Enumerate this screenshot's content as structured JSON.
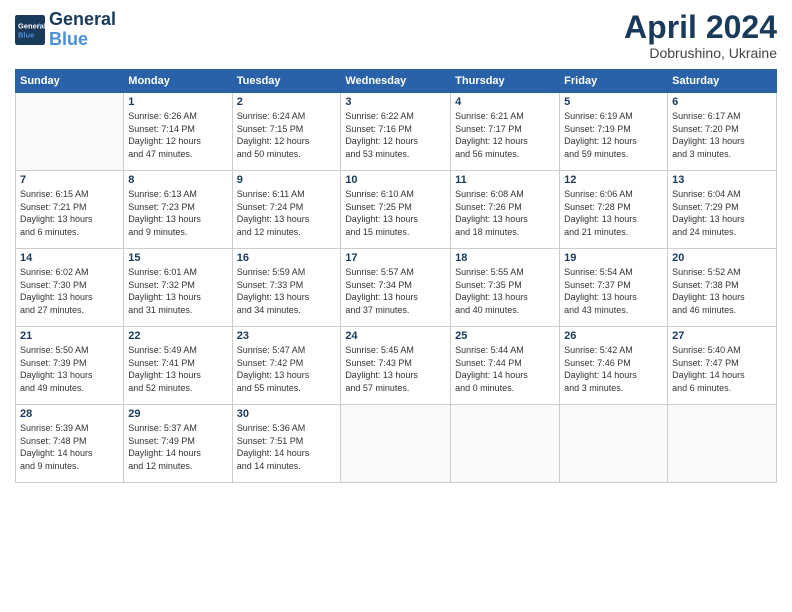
{
  "header": {
    "logo_line1": "General",
    "logo_line2": "Blue",
    "month": "April 2024",
    "location": "Dobrushino, Ukraine"
  },
  "days_of_week": [
    "Sunday",
    "Monday",
    "Tuesday",
    "Wednesday",
    "Thursday",
    "Friday",
    "Saturday"
  ],
  "weeks": [
    [
      {
        "day": "",
        "info": ""
      },
      {
        "day": "1",
        "info": "Sunrise: 6:26 AM\nSunset: 7:14 PM\nDaylight: 12 hours\nand 47 minutes."
      },
      {
        "day": "2",
        "info": "Sunrise: 6:24 AM\nSunset: 7:15 PM\nDaylight: 12 hours\nand 50 minutes."
      },
      {
        "day": "3",
        "info": "Sunrise: 6:22 AM\nSunset: 7:16 PM\nDaylight: 12 hours\nand 53 minutes."
      },
      {
        "day": "4",
        "info": "Sunrise: 6:21 AM\nSunset: 7:17 PM\nDaylight: 12 hours\nand 56 minutes."
      },
      {
        "day": "5",
        "info": "Sunrise: 6:19 AM\nSunset: 7:19 PM\nDaylight: 12 hours\nand 59 minutes."
      },
      {
        "day": "6",
        "info": "Sunrise: 6:17 AM\nSunset: 7:20 PM\nDaylight: 13 hours\nand 3 minutes."
      }
    ],
    [
      {
        "day": "7",
        "info": "Sunrise: 6:15 AM\nSunset: 7:21 PM\nDaylight: 13 hours\nand 6 minutes."
      },
      {
        "day": "8",
        "info": "Sunrise: 6:13 AM\nSunset: 7:23 PM\nDaylight: 13 hours\nand 9 minutes."
      },
      {
        "day": "9",
        "info": "Sunrise: 6:11 AM\nSunset: 7:24 PM\nDaylight: 13 hours\nand 12 minutes."
      },
      {
        "day": "10",
        "info": "Sunrise: 6:10 AM\nSunset: 7:25 PM\nDaylight: 13 hours\nand 15 minutes."
      },
      {
        "day": "11",
        "info": "Sunrise: 6:08 AM\nSunset: 7:26 PM\nDaylight: 13 hours\nand 18 minutes."
      },
      {
        "day": "12",
        "info": "Sunrise: 6:06 AM\nSunset: 7:28 PM\nDaylight: 13 hours\nand 21 minutes."
      },
      {
        "day": "13",
        "info": "Sunrise: 6:04 AM\nSunset: 7:29 PM\nDaylight: 13 hours\nand 24 minutes."
      }
    ],
    [
      {
        "day": "14",
        "info": "Sunrise: 6:02 AM\nSunset: 7:30 PM\nDaylight: 13 hours\nand 27 minutes."
      },
      {
        "day": "15",
        "info": "Sunrise: 6:01 AM\nSunset: 7:32 PM\nDaylight: 13 hours\nand 31 minutes."
      },
      {
        "day": "16",
        "info": "Sunrise: 5:59 AM\nSunset: 7:33 PM\nDaylight: 13 hours\nand 34 minutes."
      },
      {
        "day": "17",
        "info": "Sunrise: 5:57 AM\nSunset: 7:34 PM\nDaylight: 13 hours\nand 37 minutes."
      },
      {
        "day": "18",
        "info": "Sunrise: 5:55 AM\nSunset: 7:35 PM\nDaylight: 13 hours\nand 40 minutes."
      },
      {
        "day": "19",
        "info": "Sunrise: 5:54 AM\nSunset: 7:37 PM\nDaylight: 13 hours\nand 43 minutes."
      },
      {
        "day": "20",
        "info": "Sunrise: 5:52 AM\nSunset: 7:38 PM\nDaylight: 13 hours\nand 46 minutes."
      }
    ],
    [
      {
        "day": "21",
        "info": "Sunrise: 5:50 AM\nSunset: 7:39 PM\nDaylight: 13 hours\nand 49 minutes."
      },
      {
        "day": "22",
        "info": "Sunrise: 5:49 AM\nSunset: 7:41 PM\nDaylight: 13 hours\nand 52 minutes."
      },
      {
        "day": "23",
        "info": "Sunrise: 5:47 AM\nSunset: 7:42 PM\nDaylight: 13 hours\nand 55 minutes."
      },
      {
        "day": "24",
        "info": "Sunrise: 5:45 AM\nSunset: 7:43 PM\nDaylight: 13 hours\nand 57 minutes."
      },
      {
        "day": "25",
        "info": "Sunrise: 5:44 AM\nSunset: 7:44 PM\nDaylight: 14 hours\nand 0 minutes."
      },
      {
        "day": "26",
        "info": "Sunrise: 5:42 AM\nSunset: 7:46 PM\nDaylight: 14 hours\nand 3 minutes."
      },
      {
        "day": "27",
        "info": "Sunrise: 5:40 AM\nSunset: 7:47 PM\nDaylight: 14 hours\nand 6 minutes."
      }
    ],
    [
      {
        "day": "28",
        "info": "Sunrise: 5:39 AM\nSunset: 7:48 PM\nDaylight: 14 hours\nand 9 minutes."
      },
      {
        "day": "29",
        "info": "Sunrise: 5:37 AM\nSunset: 7:49 PM\nDaylight: 14 hours\nand 12 minutes."
      },
      {
        "day": "30",
        "info": "Sunrise: 5:36 AM\nSunset: 7:51 PM\nDaylight: 14 hours\nand 14 minutes."
      },
      {
        "day": "",
        "info": ""
      },
      {
        "day": "",
        "info": ""
      },
      {
        "day": "",
        "info": ""
      },
      {
        "day": "",
        "info": ""
      }
    ]
  ]
}
